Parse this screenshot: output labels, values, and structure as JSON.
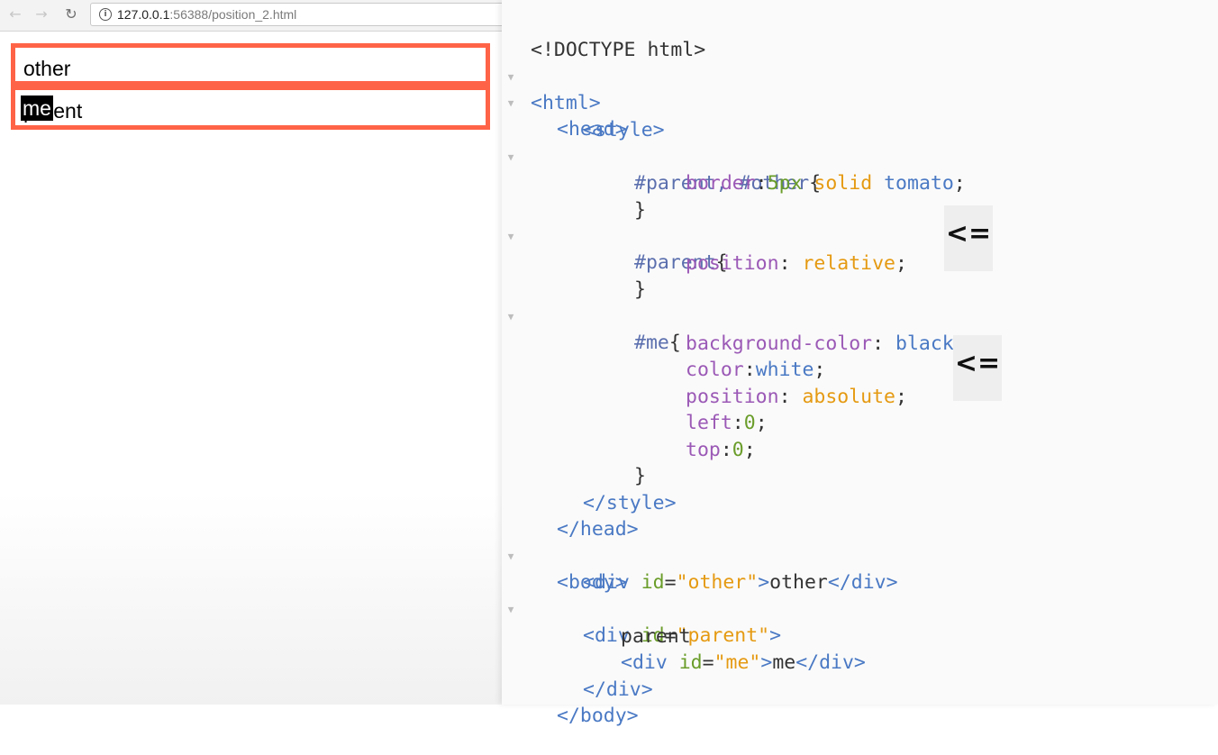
{
  "browser": {
    "url_host": "127.0.0.1",
    "url_rest": ":56388/position_2.html",
    "icons": {
      "back": "back-arrow-icon",
      "forward": "forward-arrow-icon",
      "reload": "reload-icon",
      "info": "info-icon"
    },
    "demo": {
      "other_text": "other",
      "parent_text": "parent",
      "me_text": "me"
    }
  },
  "code": {
    "l1": "<!DOCTYPE html>",
    "l2": "<html>",
    "l3": "<head>",
    "l4": "<style>",
    "l5_sel": "#parent, #other",
    "l5_brace": "{",
    "l6_prop": "border",
    "l6_val1": "5px",
    "l6_val2": "solid",
    "l6_val3": "tomato",
    "l7": "}",
    "l8_sel": "#parent",
    "l8_brace": "{",
    "l9_prop": "position",
    "l9_val": "relative",
    "l10": "}",
    "l11_sel": "#me",
    "l11_brace": "{",
    "l12_prop": "background-color",
    "l12_val": "black",
    "l13_prop": "color",
    "l13_val": "white",
    "l14_prop": "position",
    "l14_val": "absolute",
    "l15_prop": "left",
    "l15_val": "0",
    "l16_prop": "top",
    "l16_val": "0",
    "l17": "}",
    "l18": "</style>",
    "l19": "</head>",
    "l20": "<body>",
    "l21_open": "<div",
    "l21_attr": "id",
    "l21_val": "\"other\"",
    "l21_text": "other",
    "l21_close": "</div>",
    "l22_open": "<div",
    "l22_attr": "id",
    "l22_val": "\"parent\"",
    "l23_text": "parent",
    "l24_open": "<div",
    "l24_attr": "id",
    "l24_val": "\"me\"",
    "l24_text": "me",
    "l24_close": "</div>",
    "l25": "</div>",
    "l26": "</body>",
    "arrow": "<="
  },
  "colors": {
    "tomato": "#ff6347",
    "tag": "#4a79c4",
    "property": "#9b59b6",
    "keyword": "#e59a12",
    "number": "#6a9d2a"
  }
}
